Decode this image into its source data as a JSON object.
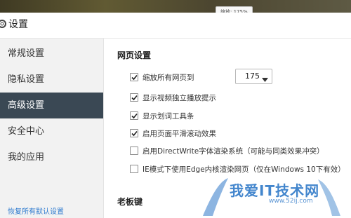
{
  "window": {
    "zoom_tooltip": "缩放: 175%"
  },
  "header": {
    "title": "设置"
  },
  "sidebar": {
    "items": [
      {
        "label": "常规设置",
        "active": false
      },
      {
        "label": "隐私设置",
        "active": false
      },
      {
        "label": "高级设置",
        "active": true
      },
      {
        "label": "安全中心",
        "active": false
      },
      {
        "label": "我的应用",
        "active": false
      }
    ],
    "restore_label": "恢复所有默认设置"
  },
  "main": {
    "webpage_section": {
      "title": "网页设置",
      "options": [
        {
          "label": "缩放所有网页到",
          "checked": true
        },
        {
          "label": "显示视频独立播放提示",
          "checked": true
        },
        {
          "label": "显示划词工具条",
          "checked": true
        },
        {
          "label": "启用页面平滑滚动效果",
          "checked": true
        },
        {
          "label": "启用DirectWrite字体渲染系统（可能与同类效果冲突）",
          "checked": false
        },
        {
          "label": "IE模式下使用Edge内核渲染网页（仅在Windows 10下有效）",
          "checked": false
        }
      ],
      "zoom_select": {
        "value": "175"
      }
    },
    "boss_key_section": {
      "title": "老板键"
    }
  },
  "watermark": {
    "text": "我爱IT技术网",
    "sub": "www.52ij.com"
  },
  "colors": {
    "sidebar_active_bg": "#3a4854",
    "link": "#2e7bcf",
    "watermark": "#2f79c8"
  }
}
